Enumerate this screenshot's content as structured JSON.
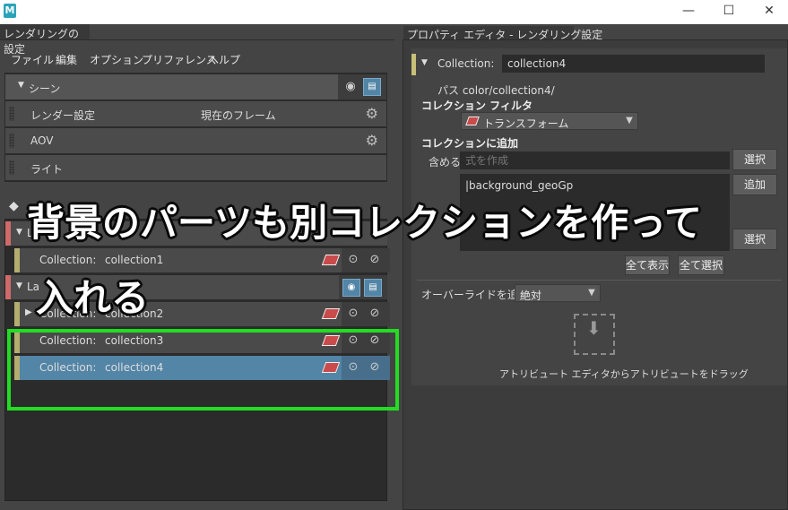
{
  "window": {
    "app_icon": "M",
    "minimize": "—",
    "maximize": "☐",
    "close": "✕"
  },
  "left_panel": {
    "tab_title": "レンダリングの設定",
    "menu": [
      "ファイル",
      "編集",
      "オプション",
      "プリファレンス",
      "ヘルプ"
    ],
    "scene": {
      "label": "シーン",
      "rows": [
        {
          "label": "レンダー設定",
          "value": "現在のフレーム"
        },
        {
          "label": "AOV"
        },
        {
          "label": "ライト"
        }
      ]
    },
    "layers": [
      {
        "label": "L"
      },
      {
        "label": "La"
      }
    ],
    "collections": [
      {
        "label": "Collection:",
        "name": "collection1"
      },
      {
        "label": "Collection:",
        "name": "collection2"
      },
      {
        "label": "Collection:",
        "name": "collection3"
      },
      {
        "label": "Collection:",
        "name": "collection4"
      }
    ]
  },
  "right_panel": {
    "tab_title": "プロパティ エディタ - レンダリング設定",
    "collection_label": "Collection:",
    "collection_value": "collection4",
    "path": "パス color/collection4/",
    "filter_label": "コレクション フィルタ",
    "filter_value": "トランスフォーム",
    "add_label": "コレクションに追加",
    "include_label": "含める",
    "include_placeholder": "式を作成",
    "select_button": "選択",
    "add_button": "追加",
    "select_button2": "選択",
    "list_items": [
      "|background_geoGp"
    ],
    "show_all_button": "全て表示",
    "select_all_button": "全て選択",
    "override_label": "オーバーライドを追加",
    "override_value": "絶対",
    "drag_hint": "アトリビュート エディタからアトリビュートをドラッグ"
  },
  "annotation": {
    "line1": "背景のパーツも別コレクションを作って",
    "line2": "入れる",
    "highlight_color": "#22dd22"
  }
}
